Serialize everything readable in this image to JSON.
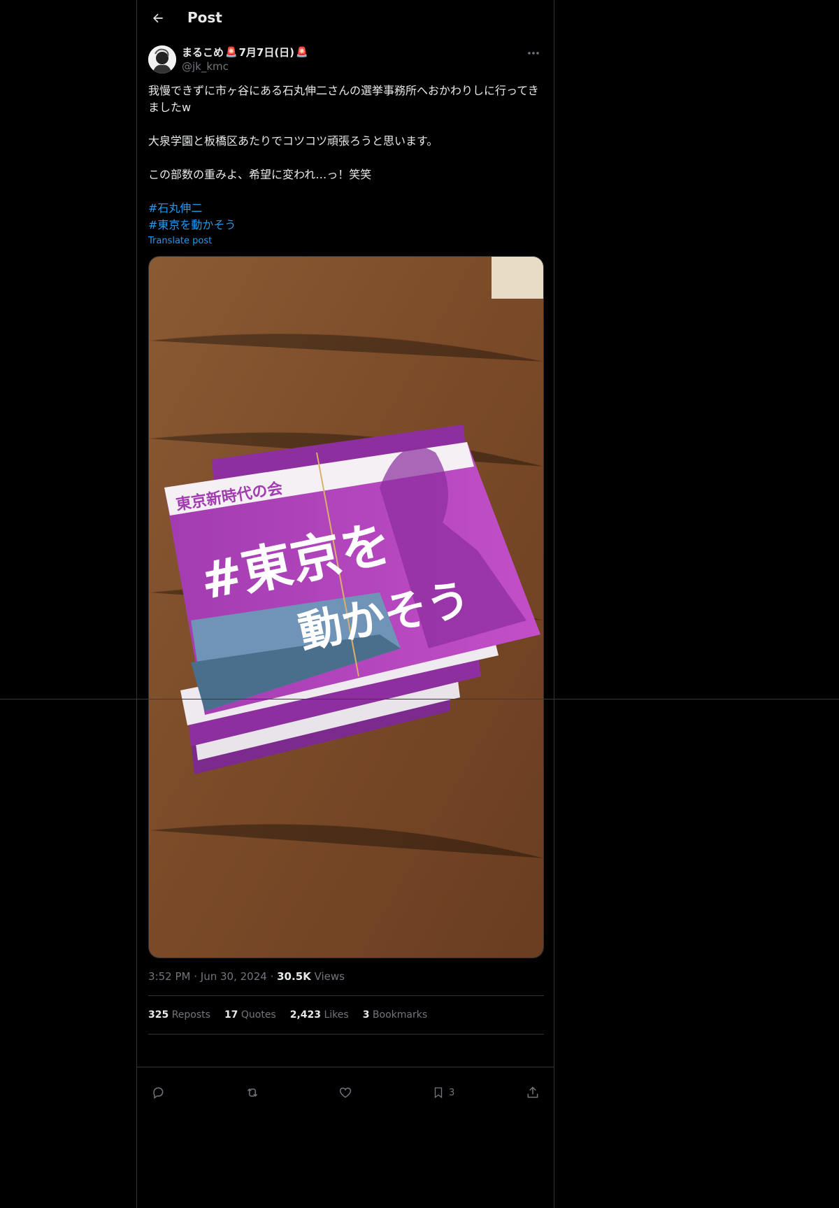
{
  "header": {
    "title": "Post"
  },
  "author": {
    "display_name": "まるこめ",
    "name_badge_1": "🚨",
    "name_date": "7月7日(日)",
    "name_badge_2": "🚨",
    "handle": "@jk_kmc"
  },
  "post": {
    "paragraphs": [
      "我慢できずに市ヶ谷にある石丸伸二さんの選挙事務所へおかわりしに行ってきましたw",
      "大泉学園と板橋区あたりでコツコツ頑張ろうと思います。",
      "この部数の重みよ、希望に変われ…っ！笑笑"
    ],
    "hashtags": [
      "#石丸伸二",
      "#東京を動かそう"
    ],
    "translate_label": "Translate post"
  },
  "media": {
    "flyer_org": "東京新時代の会",
    "flyer_slogan_1": "#東京を",
    "flyer_slogan_2": "動かそう"
  },
  "meta": {
    "time": "3:52 PM",
    "date": "Jun 30, 2024",
    "views_count": "30.5K",
    "views_label": "Views"
  },
  "stats": {
    "reposts_count": "325",
    "reposts_label": "Reposts",
    "quotes_count": "17",
    "quotes_label": "Quotes",
    "likes_count": "2,423",
    "likes_label": "Likes",
    "bookmarks_count": "3",
    "bookmarks_label": "Bookmarks"
  },
  "actions": {
    "bookmark_count": "3"
  },
  "icons": [
    "back-arrow-icon",
    "more-icon",
    "reply-icon",
    "repost-icon",
    "like-icon",
    "bookmark-icon",
    "share-icon"
  ],
  "colors": {
    "link": "#1d9bf0",
    "muted": "#71767b",
    "text": "#e7e9ea",
    "border": "#2f3336",
    "flyer_purple": "#9b2fae"
  }
}
